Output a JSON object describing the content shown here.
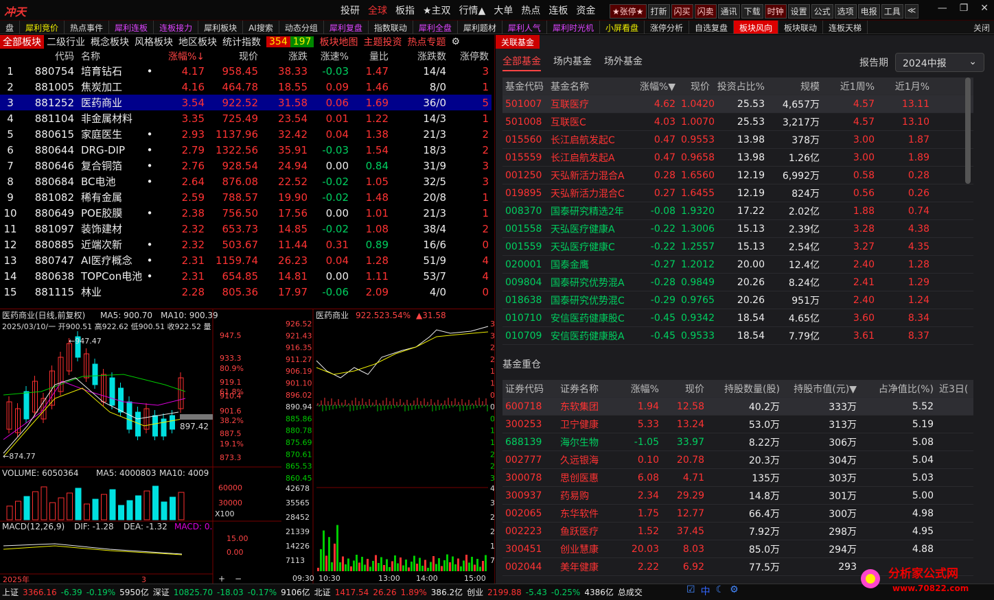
{
  "app": {
    "logo": "冲天",
    "menu": [
      "投研",
      "全球",
      "板指",
      "★主双",
      "行情▲",
      "大单",
      "热点",
      "连板",
      "资金"
    ],
    "menu_hl": [
      1
    ],
    "buttons": [
      "★张停★",
      "打新",
      "闪买",
      "闪卖",
      "通讯",
      "下载",
      "时钟",
      "设置",
      "公式",
      "选项",
      "电报",
      "工具",
      "≪"
    ]
  },
  "tabs": [
    "盘",
    "犀利竞价",
    "热点事件",
    "犀利连板",
    "连板接力",
    "犀利板块",
    "AI搜索",
    "动态分组",
    "犀利复盘",
    "指数联动",
    "犀利全盘",
    "犀利题材",
    "犀利人气",
    "犀利时光机",
    "小屏看盘",
    "涨停分析",
    "自选复盘",
    "板块风向",
    "板块联动",
    "连板天梯"
  ],
  "tab_styles": [
    "",
    "y",
    "",
    "m",
    "m",
    "",
    "",
    "",
    "m",
    "",
    "m",
    "",
    "m",
    "m",
    "y",
    "",
    "",
    "act",
    "",
    ""
  ],
  "tab_close": "关闭",
  "subtabs": {
    "items": [
      "全部板块",
      "二级行业",
      "概念板块",
      "风格板块",
      "地区板块",
      "统计指数"
    ],
    "up": "354",
    "down": "197",
    "extra": [
      "板块地图",
      "主题投资",
      "热点专题"
    ]
  },
  "sector_table": {
    "headers": [
      "",
      "代码",
      "名称",
      "",
      "涨幅%↓",
      "现价",
      "涨跌",
      "涨速%",
      "量比",
      "涨跌数",
      "涨停数"
    ],
    "rows": [
      [
        "1",
        "880754",
        "培育钻石",
        "•",
        "4.17",
        "958.45",
        "38.33",
        "-0.03",
        "1.47",
        "14/4",
        "3"
      ],
      [
        "2",
        "881005",
        "焦炭加工",
        "",
        "4.16",
        "464.78",
        "18.55",
        "0.09",
        "1.46",
        "8/0",
        "1"
      ],
      [
        "3",
        "881252",
        "医药商业",
        "",
        "3.54",
        "922.52",
        "31.58",
        "0.06",
        "1.69",
        "36/0",
        "5"
      ],
      [
        "4",
        "881104",
        "非金属材料",
        "",
        "3.35",
        "725.49",
        "23.54",
        "0.01",
        "1.22",
        "14/3",
        "1"
      ],
      [
        "5",
        "880615",
        "家庭医生",
        "•",
        "2.93",
        "1137.96",
        "32.42",
        "0.04",
        "1.38",
        "21/3",
        "2"
      ],
      [
        "6",
        "880644",
        "DRG-DIP",
        "•",
        "2.79",
        "1322.56",
        "35.91",
        "-0.03",
        "1.54",
        "18/3",
        "2"
      ],
      [
        "7",
        "880646",
        "复合铜箔",
        "•",
        "2.76",
        "928.54",
        "24.94",
        "0.00",
        "0.84",
        "31/9",
        "3"
      ],
      [
        "8",
        "880684",
        "BC电池",
        "•",
        "2.64",
        "876.08",
        "22.52",
        "-0.02",
        "1.05",
        "32/5",
        "3"
      ],
      [
        "9",
        "881082",
        "稀有金属",
        "",
        "2.59",
        "788.57",
        "19.90",
        "-0.02",
        "1.48",
        "20/8",
        "1"
      ],
      [
        "10",
        "880649",
        "POE胶膜",
        "•",
        "2.38",
        "756.50",
        "17.56",
        "0.00",
        "1.01",
        "21/3",
        "1"
      ],
      [
        "11",
        "881097",
        "装饰建材",
        "",
        "2.32",
        "653.73",
        "14.85",
        "-0.02",
        "1.08",
        "38/4",
        "2"
      ],
      [
        "12",
        "880885",
        "近端次新",
        "•",
        "2.32",
        "503.67",
        "11.44",
        "0.31",
        "0.89",
        "16/6",
        "0"
      ],
      [
        "13",
        "880747",
        "AI医疗概念",
        "•",
        "2.31",
        "1159.74",
        "26.23",
        "0.04",
        "1.28",
        "51/9",
        "4"
      ],
      [
        "14",
        "880638",
        "TOPCon电池",
        "•",
        "2.31",
        "654.85",
        "14.81",
        "0.00",
        "1.11",
        "53/7",
        "4"
      ],
      [
        "15",
        "881115",
        "林业",
        "",
        "2.28",
        "805.36",
        "17.97",
        "-0.06",
        "2.09",
        "4/0",
        "0"
      ]
    ],
    "selected": 2
  },
  "kline": {
    "title": "医药商业(日线,前复权)",
    "ma5": "MA5: 900.70",
    "ma10": "MA10: 900.39",
    "date_line": "2025/03/10/一 开900.51 高922.62 低900.51 收922.52 量",
    "high_label": "947.47",
    "low_label": "874.77",
    "price_tag": "897.42",
    "yticks": [
      "947.5",
      "933.3",
      "919.1",
      "910.4",
      "901.6",
      "887.5",
      "873.3"
    ],
    "pticks": [
      "80.9%",
      "61.8%",
      "38.2%",
      "19.1%"
    ],
    "vol_title": "VOLUME: 6050364",
    "vol_ma5": "MA5: 4000803",
    "vol_ma10": "MA10: 4009",
    "vol_ticks": [
      "60000",
      "30000",
      "X100"
    ],
    "macd_title": "MACD(12,26,9)",
    "macd_dif": "DIF: -1.28",
    "macd_dea": "DEA: -1.32",
    "macd_val": "MACD: 0.",
    "macd_ticks": [
      "15.00",
      "0.00"
    ],
    "xlabel_left": "2025年",
    "xlabel_mid": "3",
    "pm": [
      "+",
      "−"
    ]
  },
  "timeshare": {
    "title": "医药商业",
    "price": "922.52",
    "pct": "3.54%",
    "chg": "▲31.58",
    "left_ticks": [
      "926.52",
      "921.43",
      "916.35",
      "911.27",
      "906.19",
      "901.10",
      "896.02",
      "890.94",
      "885.86",
      "880.78",
      "875.69",
      "870.61",
      "865.53",
      "860.45"
    ],
    "right_ticks": [
      "3.99%",
      "3.42%",
      "2.85%",
      "2.28%",
      "1.71%",
      "1.14%",
      "0.57%",
      "0.00%",
      "0.57%",
      "1.14%",
      "1.71%",
      "2.28%",
      "2.85%",
      "3.42%"
    ],
    "vol_ticks": [
      "42678",
      "35565",
      "28452",
      "21339",
      "14226",
      "7113"
    ],
    "times": [
      "09:30",
      "10:30",
      "13:00",
      "14:00",
      "15:00"
    ]
  },
  "fund_panel": {
    "header": "关联基金",
    "tabs": [
      "全部基金",
      "场内基金",
      "场外基金"
    ],
    "period_label": "报告期",
    "period_value": "2024中报",
    "headers": [
      "基金代码",
      "基金名称",
      "涨幅%▼",
      "现价",
      "投资占比%",
      "规模",
      "近1周%",
      "近1月%"
    ],
    "rows": [
      [
        "501007",
        "互联医疗",
        "4.62",
        "1.0420",
        "25.53",
        "4,657万",
        "4.57",
        "13.11"
      ],
      [
        "501008",
        "互联医C",
        "4.03",
        "1.0070",
        "25.53",
        "3,217万",
        "4.57",
        "13.10"
      ],
      [
        "015560",
        "长江启航发起C",
        "0.47",
        "0.9553",
        "13.98",
        "378万",
        "3.00",
        "1.87"
      ],
      [
        "015559",
        "长江启航发起A",
        "0.47",
        "0.9658",
        "13.98",
        "1.26亿",
        "3.00",
        "1.89"
      ],
      [
        "001250",
        "天弘新活力混合A",
        "0.28",
        "1.6560",
        "12.19",
        "6,992万",
        "0.58",
        "0.28"
      ],
      [
        "019895",
        "天弘新活力混合C",
        "0.27",
        "1.6455",
        "12.19",
        "824万",
        "0.56",
        "0.26"
      ],
      [
        "008370",
        "国泰研究精选2年",
        "-0.08",
        "1.9320",
        "17.22",
        "2.02亿",
        "1.88",
        "0.74"
      ],
      [
        "001558",
        "天弘医疗健康A",
        "-0.22",
        "1.3006",
        "15.13",
        "2.39亿",
        "3.28",
        "4.38"
      ],
      [
        "001559",
        "天弘医疗健康C",
        "-0.22",
        "1.2557",
        "15.13",
        "2.54亿",
        "3.27",
        "4.35"
      ],
      [
        "020001",
        "国泰金鹰",
        "-0.27",
        "1.2012",
        "20.00",
        "12.4亿",
        "2.40",
        "1.28"
      ],
      [
        "009804",
        "国泰研究优势混A",
        "-0.28",
        "0.9849",
        "20.26",
        "8.24亿",
        "2.41",
        "1.29"
      ],
      [
        "018638",
        "国泰研究优势混C",
        "-0.29",
        "0.9765",
        "20.26",
        "951万",
        "2.40",
        "1.24"
      ],
      [
        "010710",
        "安信医药健康股C",
        "-0.45",
        "0.9342",
        "18.54",
        "4.65亿",
        "3.60",
        "8.34"
      ],
      [
        "010709",
        "安信医药健康股A",
        "-0.45",
        "0.9533",
        "18.54",
        "7.79亿",
        "3.61",
        "8.37"
      ]
    ],
    "section_title": "基金重仓",
    "hold_headers": [
      "证券代码",
      "证券名称",
      "涨幅%",
      "现价",
      "持股数量(股)",
      "持股市值(元)▼",
      "占净值比(%)",
      "近3日("
    ],
    "hold_rows": [
      [
        "600718",
        "东软集团",
        "1.94",
        "12.58",
        "40.2万",
        "333万",
        "5.52"
      ],
      [
        "300253",
        "卫宁健康",
        "5.33",
        "13.24",
        "53.0万",
        "313万",
        "5.19"
      ],
      [
        "688139",
        "海尔生物",
        "-1.05",
        "33.97",
        "8.22万",
        "306万",
        "5.08"
      ],
      [
        "002777",
        "久远银海",
        "0.10",
        "20.78",
        "20.3万",
        "304万",
        "5.04"
      ],
      [
        "300078",
        "思创医惠",
        "6.08",
        "4.71",
        "135万",
        "303万",
        "5.03"
      ],
      [
        "300937",
        "药易购",
        "2.34",
        "29.29",
        "14.8万",
        "301万",
        "5.00"
      ],
      [
        "002065",
        "东华软件",
        "1.75",
        "12.77",
        "66.4万",
        "300万",
        "4.98"
      ],
      [
        "002223",
        "鱼跃医疗",
        "1.52",
        "37.45",
        "7.92万",
        "298万",
        "4.95"
      ],
      [
        "300451",
        "创业慧康",
        "20.03",
        "8.03",
        "85.0万",
        "294万",
        "4.88"
      ],
      [
        "002044",
        "美年健康",
        "2.22",
        "6.92",
        "77.5万",
        "293",
        ""
      ]
    ]
  },
  "statusbar": {
    "items": [
      [
        "上证",
        "white"
      ],
      [
        "3366.16",
        "red"
      ],
      [
        "-6.39",
        "green"
      ],
      [
        "-0.19%",
        "green"
      ],
      [
        "5950亿",
        "white"
      ],
      [
        "深证",
        "white"
      ],
      [
        "10825.70",
        "green"
      ],
      [
        "-18.03",
        "green"
      ],
      [
        "-0.17%",
        "green"
      ],
      [
        "9106亿",
        "white"
      ],
      [
        "北证",
        "white"
      ],
      [
        "1417.54",
        "red"
      ],
      [
        "26.26",
        "red"
      ],
      [
        "1.89%",
        "red"
      ],
      [
        "386.2亿",
        "white"
      ],
      [
        "创业",
        "white"
      ],
      [
        "2199.88",
        "red"
      ],
      [
        "-5.43",
        "green"
      ],
      [
        "-0.25%",
        "green"
      ],
      [
        "4386亿",
        "white"
      ],
      [
        "总成交",
        "white"
      ]
    ]
  },
  "watermark": {
    "text": "分析家公式网",
    "url": "www.70822.com"
  }
}
